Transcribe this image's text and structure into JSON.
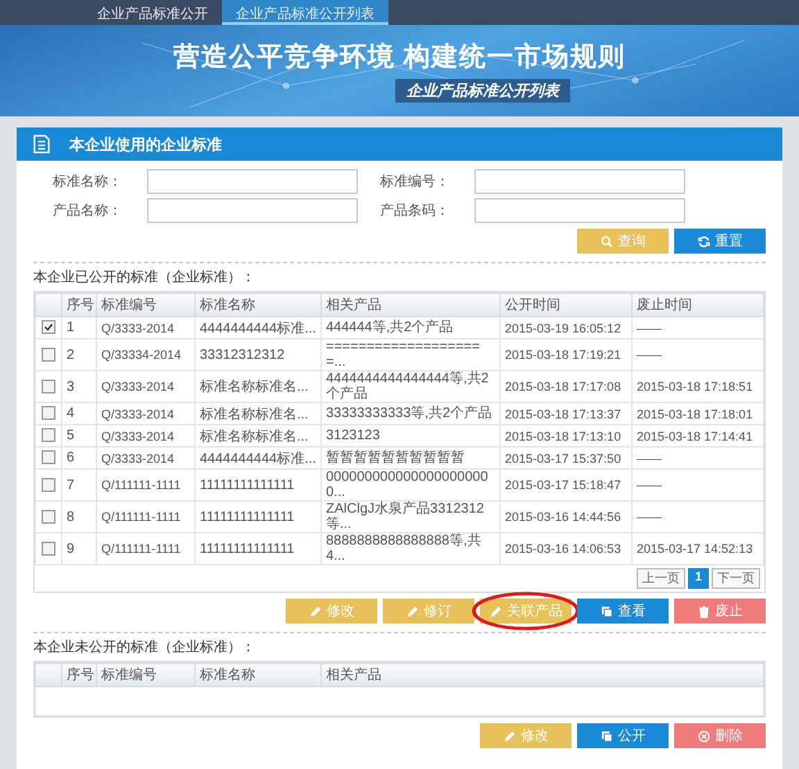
{
  "nav": {
    "tabs": [
      {
        "label": "企业产品标准公开",
        "selected": false
      },
      {
        "label": "企业产品标准公开列表",
        "selected": true
      }
    ]
  },
  "banner": {
    "title": "营造公平竞争环境 构建统一市场规则",
    "subtitle": "企业产品标准公开列表"
  },
  "panel": {
    "title": "本企业使用的企业标准"
  },
  "search_form": {
    "fields": [
      {
        "label": "标准名称："
      },
      {
        "label": "标准编号："
      },
      {
        "label": "产品名称："
      },
      {
        "label": "产品条码："
      }
    ],
    "buttons": [
      {
        "label": "查询",
        "kind": "warning"
      },
      {
        "label": "重置",
        "kind": "primary"
      }
    ]
  },
  "public_section": {
    "title": "本企业已公开的标准（企业标准）：",
    "columns": [
      "序号",
      "标准编号",
      "标准名称",
      "相关产品",
      "公开时间",
      "废止时间"
    ],
    "rows": [
      {
        "checked": true,
        "cells": [
          "1",
          "Q/3333-2014",
          "4444444444标准...",
          "444444等,共2个产品",
          "2015-03-19 16:05:12",
          "——"
        ]
      },
      {
        "checked": false,
        "cells": [
          "2",
          "Q/33334-2014",
          "33312312312",
          "====================...",
          "2015-03-18 17:19:21",
          "——"
        ]
      },
      {
        "checked": false,
        "cells": [
          "3",
          "Q/3333-2014",
          "标准名称标准名...",
          "4444444444444444等,共2个产品",
          "2015-03-18 17:17:08",
          "2015-03-18 17:18:51"
        ]
      },
      {
        "checked": false,
        "cells": [
          "4",
          "Q/3333-2014",
          "标准名称标准名...",
          "33333333333等,共2个产品",
          "2015-03-18 17:13:37",
          "2015-03-18 17:18:01"
        ]
      },
      {
        "checked": false,
        "cells": [
          "5",
          "Q/3333-2014",
          "标准名称标准名...",
          "3123123",
          "2015-03-18 17:13:10",
          "2015-03-18 17:14:41"
        ]
      },
      {
        "checked": false,
        "cells": [
          "6",
          "Q/3333-2014",
          "4444444444标准...",
          "暂暂暂暂暂暂暂暂暂暂",
          "2015-03-17 15:37:50",
          "——"
        ]
      },
      {
        "checked": false,
        "cells": [
          "7",
          "Q/111111-1111",
          "11111111111111",
          "0000000000000000000000...",
          "2015-03-17 15:18:47",
          "——"
        ]
      },
      {
        "checked": false,
        "cells": [
          "8",
          "Q/111111-1111",
          "11111111111111",
          "ZAlClgJ水泉产品3312312等...",
          "2015-03-16 14:44:56",
          "——"
        ]
      },
      {
        "checked": false,
        "cells": [
          "9",
          "Q/111111-1111",
          "11111111111111",
          "8888888888888888等,共4...",
          "2015-03-16 14:06:53",
          "2015-03-17 14:52:13"
        ]
      }
    ],
    "pagination": [
      {
        "label": "上一页",
        "kind": "prev",
        "selected": false
      },
      {
        "label": "1",
        "kind": "page",
        "selected": true
      },
      {
        "label": "下一页",
        "kind": "next",
        "selected": false
      }
    ],
    "buttons": [
      {
        "label": "修改",
        "kind": "warning",
        "circled": false
      },
      {
        "label": "修订",
        "kind": "warning",
        "circled": false
      },
      {
        "label": "关联产品",
        "kind": "warning",
        "circled": true
      },
      {
        "label": "查看",
        "kind": "primary",
        "circled": false
      },
      {
        "label": "废止",
        "kind": "danger",
        "circled": false
      }
    ]
  },
  "private_section": {
    "title": "本企业未公开的标准（企业标准）：",
    "columns": [
      "序号",
      "标准编号",
      "标准名称",
      "相关产品"
    ],
    "buttons": [
      {
        "label": "修改",
        "kind": "warning"
      },
      {
        "label": "公开",
        "kind": "primary"
      },
      {
        "label": "删除",
        "kind": "danger"
      }
    ]
  }
}
